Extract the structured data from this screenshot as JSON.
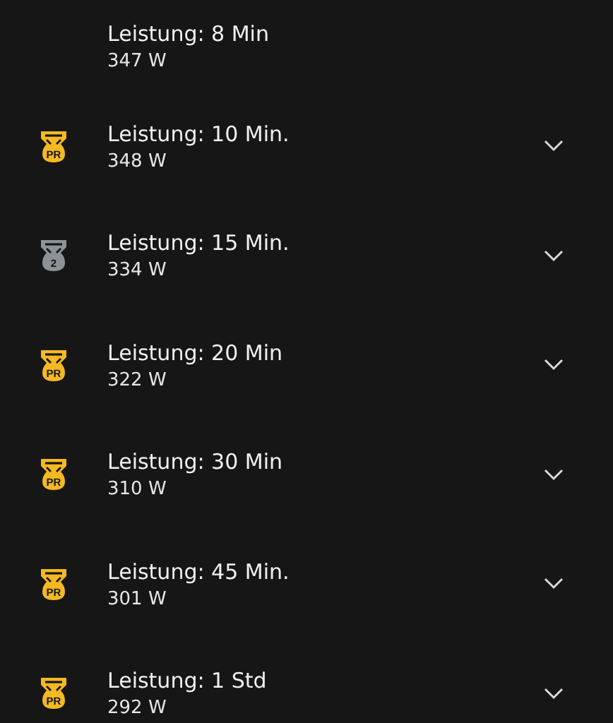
{
  "records": [
    {
      "title": "Leistung: 8 Min",
      "value": "347 W",
      "expandable": false
    },
    {
      "title": "Leistung: 10 Min.",
      "value": "348 W",
      "expandable": true,
      "medal": {
        "kind": "pr",
        "label": "PR"
      }
    },
    {
      "title": "Leistung: 15 Min.",
      "value": "334 W",
      "expandable": true,
      "medal": {
        "kind": "rank",
        "label": "2"
      }
    },
    {
      "title": "Leistung: 20 Min",
      "value": "322 W",
      "expandable": true,
      "medal": {
        "kind": "pr",
        "label": "PR"
      }
    },
    {
      "title": "Leistung: 30 Min",
      "value": "310 W",
      "expandable": true,
      "medal": {
        "kind": "pr",
        "label": "PR"
      }
    },
    {
      "title": "Leistung: 45 Min.",
      "value": "301 W",
      "expandable": true,
      "medal": {
        "kind": "pr",
        "label": "PR"
      }
    },
    {
      "title": "Leistung: 1 Std",
      "value": "292 W",
      "expandable": true,
      "medal": {
        "kind": "pr",
        "label": "PR"
      }
    }
  ]
}
